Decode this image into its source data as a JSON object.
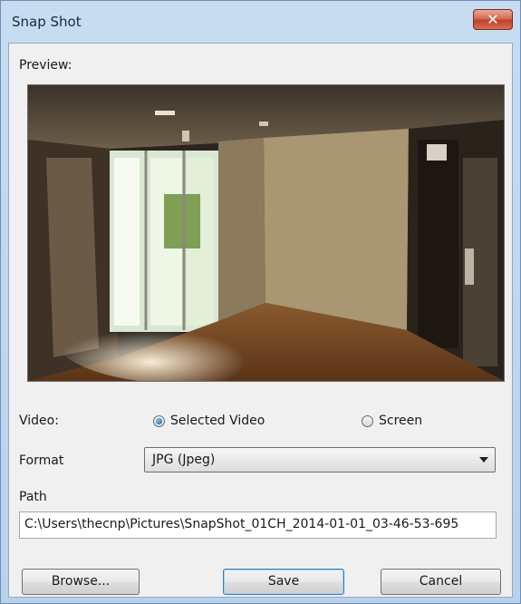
{
  "window": {
    "title": "Snap Shot",
    "close_glyph": "✕"
  },
  "preview": {
    "label": "Preview:"
  },
  "video": {
    "label": "Video:",
    "options": [
      {
        "label": "Selected Video",
        "checked": true
      },
      {
        "label": "Screen",
        "checked": false
      }
    ]
  },
  "format": {
    "label": "Format",
    "value": "JPG (Jpeg)"
  },
  "path": {
    "label": "Path",
    "value": "C:\\Users\\thecnp\\Pictures\\SnapShot_01CH_2014-01-01_03-46-53-695"
  },
  "buttons": {
    "browse": "Browse...",
    "save": "Save",
    "cancel": "Cancel"
  }
}
